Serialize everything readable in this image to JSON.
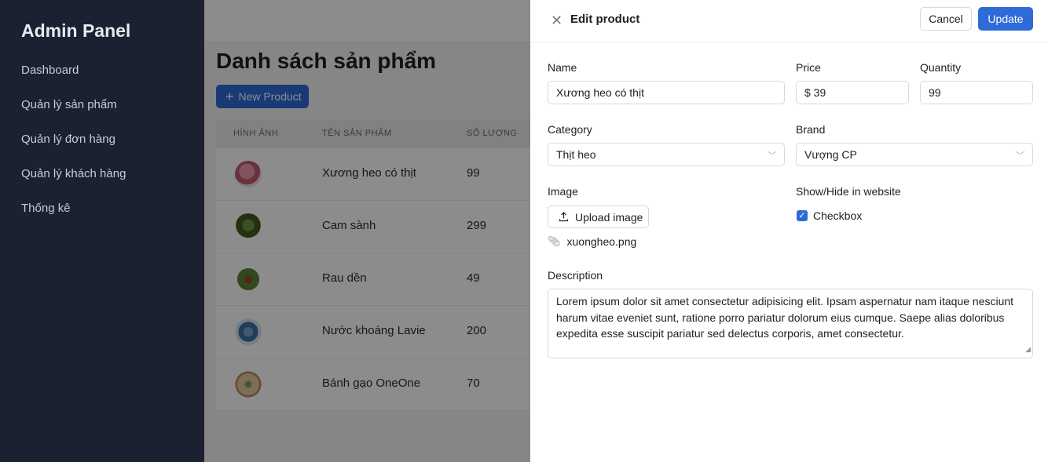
{
  "sidebar": {
    "brand": "Admin Panel",
    "items": [
      {
        "label": "Dashboard"
      },
      {
        "label": "Quản lý sản phẩm"
      },
      {
        "label": "Quản lý đơn hàng"
      },
      {
        "label": "Quản lý khách hàng"
      },
      {
        "label": "Thống kê"
      }
    ]
  },
  "main": {
    "title": "Danh sách sản phẩm",
    "new_button": "New Product",
    "table": {
      "headers": [
        "HÌNH ẢNH",
        "TÊN SẢN PHẨM",
        "SỐ LƯỢNG"
      ],
      "rows": [
        {
          "name": "Xương heo có thịt",
          "qty": "99",
          "color": "#d9748a"
        },
        {
          "name": "Cam sành",
          "qty": "299",
          "color": "#4a6a2c"
        },
        {
          "name": "Rau dền",
          "qty": "49",
          "color": "#5a7a34"
        },
        {
          "name": "Nước khoáng Lavie",
          "qty": "200",
          "color": "#4f86b8"
        },
        {
          "name": "Bánh gạo OneOne",
          "qty": "70",
          "color": "#c9a27a"
        }
      ]
    }
  },
  "drawer": {
    "title": "Edit product",
    "cancel": "Cancel",
    "update": "Update",
    "name_label": "Name",
    "name_value": "Xương heo có thịt",
    "price_label": "Price",
    "price_value": "$ 39",
    "quantity_label": "Quantity",
    "quantity_value": "99",
    "category_label": "Category",
    "category_value": "Thịt heo",
    "brand_label": "Brand",
    "brand_value": "Vượng CP",
    "image_label": "Image",
    "upload_label": "Upload image",
    "file_name": "xuongheo.png",
    "show_label": "Show/Hide in website",
    "checkbox_label": "Checkbox",
    "checkbox_checked": true,
    "description_label": "Description",
    "description_value": "Lorem ipsum dolor sit amet consectetur adipisicing elit. Ipsam aspernatur nam itaque nesciunt harum vitae eveniet sunt, ratione porro pariatur dolorum eius cumque. Saepe alias doloribus expedita esse suscipit pariatur sed delectus corporis, amet consectetur."
  },
  "colors": {
    "sidebar_bg": "#1b2130",
    "primary": "#2f6bd8"
  }
}
